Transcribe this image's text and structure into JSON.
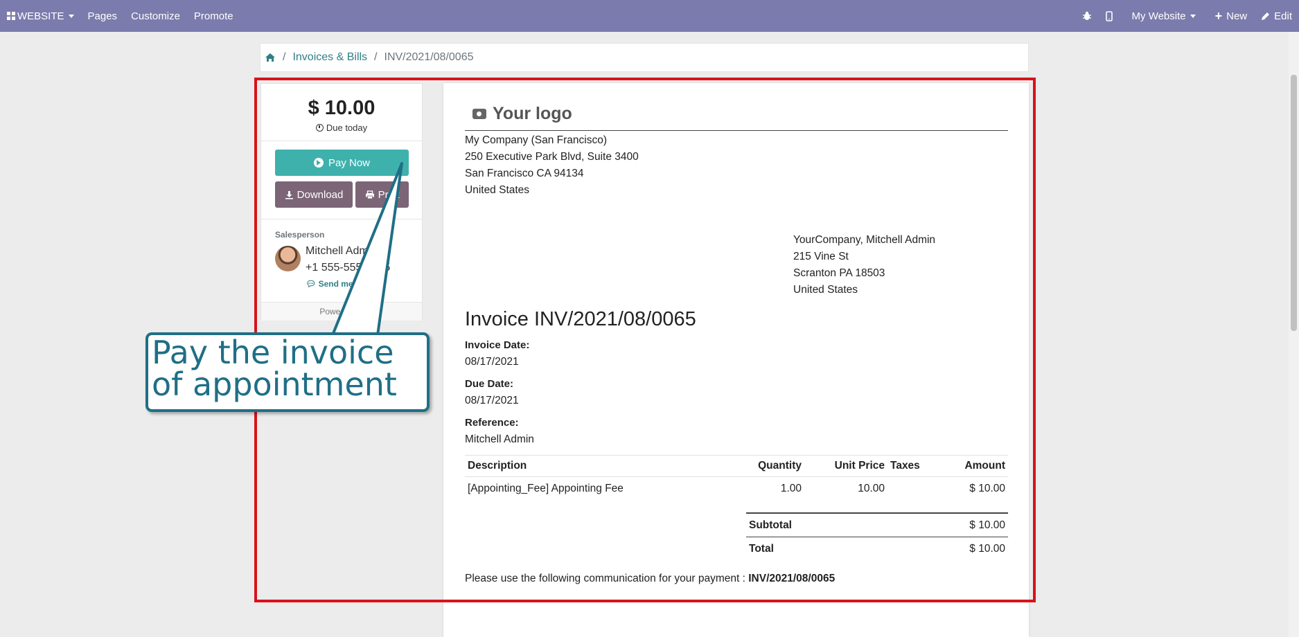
{
  "topnav": {
    "website_label": "WEBSITE",
    "pages_label": "Pages",
    "customize_label": "Customize",
    "promote_label": "Promote",
    "my_website_label": "My Website",
    "new_label": "New",
    "edit_label": "Edit",
    "bar_color": "#7c7bad"
  },
  "breadcrumb": {
    "items": [
      "Invoices & Bills",
      "INV/2021/08/0065"
    ]
  },
  "sidebar": {
    "amount": "$ 10.00",
    "due_label": "Due today",
    "pay_now_label": "Pay Now",
    "download_label": "Download",
    "print_label": "Print",
    "salesperson_label": "Salesperson",
    "salesperson_name": "Mitchell Admin",
    "salesperson_phone": "+1 555-555-5555",
    "send_message_label": "Send message",
    "powered_label": "Powered by"
  },
  "document": {
    "logo_text": "Your logo",
    "company_address": [
      "My Company (San Francisco)",
      "250 Executive Park Blvd, Suite 3400",
      "San Francisco CA 94134",
      "United States"
    ],
    "customer_address": [
      "YourCompany, Mitchell Admin",
      "215 Vine St",
      "Scranton PA 18503",
      "United States"
    ],
    "title": "Invoice INV/2021/08/0065",
    "invoice_date_label": "Invoice Date:",
    "invoice_date": "08/17/2021",
    "due_date_label": "Due Date:",
    "due_date": "08/17/2021",
    "reference_label": "Reference:",
    "reference": "Mitchell Admin",
    "table": {
      "headers": [
        "Description",
        "Quantity",
        "Unit Price",
        "Taxes",
        "Amount"
      ],
      "rows": [
        [
          "[Appointing_Fee] Appointing Fee",
          "1.00",
          "10.00",
          "",
          "$ 10.00"
        ]
      ]
    },
    "subtotal_label": "Subtotal",
    "subtotal": "$ 10.00",
    "total_label": "Total",
    "total": "$ 10.00",
    "communication_text": "Please use the following communication for your payment :",
    "communication_ref": "INV/2021/08/0065"
  },
  "annotation": {
    "callout_text": "Pay the invoice of appointment",
    "highlight_color": "#d8131b",
    "callout_color": "#1f6f86"
  }
}
